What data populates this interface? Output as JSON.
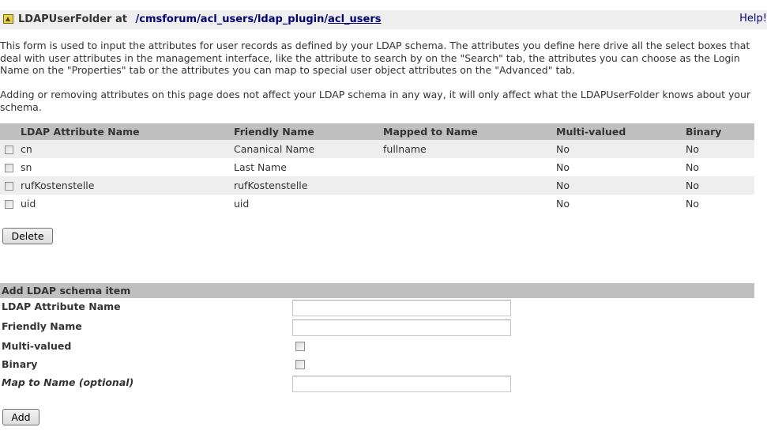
{
  "title_bar": {
    "prefix": "LDAPUserFolder at",
    "path_segments": [
      {
        "label": "/cmsforum",
        "linked": false
      },
      {
        "label": "/acl_users",
        "linked": false
      },
      {
        "label": "/ldap_plugin",
        "linked": false
      },
      {
        "label": "/",
        "linked": false
      },
      {
        "label": "acl_users",
        "linked": true
      }
    ],
    "help_label": "Help!"
  },
  "intro": {
    "paragraph1": "This form is used to input the attributes for user records as defined by your LDAP schema. The attributes you define here drive all the select boxes that deal with user attributes in the management interface, like the attribute to search by on the \"Search\" tab, the attributes you can choose as the Login Name on the \"Properties\" tab or the attributes you can map to special user object attributes on the \"Advanced\" tab.",
    "paragraph2": "Adding or removing attributes on this page does not affect your LDAP schema in any way, it will only affect what the LDAPUserFolder knows about your schema."
  },
  "table": {
    "columns": [
      "LDAP Attribute Name",
      "Friendly Name",
      "Mapped to Name",
      "Multi-valued",
      "Binary"
    ],
    "rows": [
      {
        "ldap_name": "cn",
        "friendly_name": "Cananical Name",
        "mapped_to": "fullname",
        "multi_valued": "No",
        "binary": "No",
        "checked": false
      },
      {
        "ldap_name": "sn",
        "friendly_name": "Last Name",
        "mapped_to": "",
        "multi_valued": "No",
        "binary": "No",
        "checked": false
      },
      {
        "ldap_name": "rufKostenstelle",
        "friendly_name": "rufKostenstelle",
        "mapped_to": "",
        "multi_valued": "No",
        "binary": "No",
        "checked": false
      },
      {
        "ldap_name": "uid",
        "friendly_name": "uid",
        "mapped_to": "",
        "multi_valued": "No",
        "binary": "No",
        "checked": false
      }
    ],
    "delete_label": "Delete"
  },
  "add_form": {
    "header": "Add LDAP schema item",
    "fields": {
      "ldap_attribute_name": {
        "label": "LDAP Attribute Name",
        "value": ""
      },
      "friendly_name": {
        "label": "Friendly Name",
        "value": ""
      },
      "multi_valued": {
        "label": "Multi-valued",
        "checked": false
      },
      "binary": {
        "label": "Binary",
        "checked": false
      },
      "map_to_name": {
        "label": "Map to Name (optional)",
        "value": ""
      }
    },
    "add_label": "Add"
  },
  "colors": {
    "header_gray": "#c0c0c0",
    "title_bar_bg": "#efefef",
    "row_alt_bg": "#eeeeee",
    "link_color": "#000070"
  }
}
